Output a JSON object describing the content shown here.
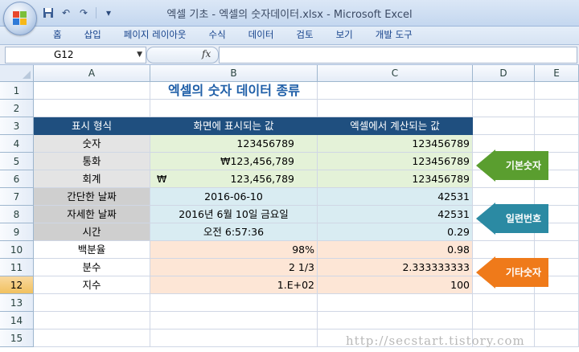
{
  "window": {
    "title": "엑셀 기초 - 엑셀의 숫자데이터.xlsx - Microsoft Excel"
  },
  "menu": [
    "홈",
    "삽입",
    "페이지 레이아웃",
    "수식",
    "데이터",
    "검토",
    "보기",
    "개발 도구"
  ],
  "formula_bar": {
    "name_box": "G12",
    "fx_label": "fx",
    "formula": ""
  },
  "columns": [
    "A",
    "B",
    "C",
    "D",
    "E"
  ],
  "rows": [
    "1",
    "2",
    "3",
    "4",
    "5",
    "6",
    "7",
    "8",
    "9",
    "10",
    "11",
    "12",
    "13",
    "14",
    "15"
  ],
  "selected_cell": "G12",
  "sheet": {
    "title": "엑셀의 숫자 데이터 종류",
    "headers": [
      "표시 형식",
      "화면에 표시되는 값",
      "엑셀에서 계산되는 값"
    ],
    "data": [
      {
        "type": "숫자",
        "display": "123456789",
        "value": "123456789"
      },
      {
        "type": "통화",
        "display": "₩123,456,789",
        "value": "123456789"
      },
      {
        "type": "회계",
        "display_symbol": "₩",
        "display": "123,456,789",
        "value": "123456789"
      },
      {
        "type": "간단한 날짜",
        "display": "2016-06-10",
        "value": "42531"
      },
      {
        "type": "자세한 날짜",
        "display": "2016년 6월 10일 금요일",
        "value": "42531"
      },
      {
        "type": "시간",
        "display": "오전 6:57:36",
        "value": "0.29"
      },
      {
        "type": "백분율",
        "display": "98%",
        "value": "0.98"
      },
      {
        "type": "분수",
        "display": "2 1/3",
        "value": "2.333333333"
      },
      {
        "type": "지수",
        "display": "1.E+02",
        "value": "100"
      }
    ]
  },
  "callouts": [
    {
      "label": "기본숫자",
      "color": "#5a9e2f"
    },
    {
      "label": "일련번호",
      "color": "#2b8aa3"
    },
    {
      "label": "기타숫자",
      "color": "#ef7a1a"
    }
  ],
  "watermark": "http://secstart.tistory.com"
}
